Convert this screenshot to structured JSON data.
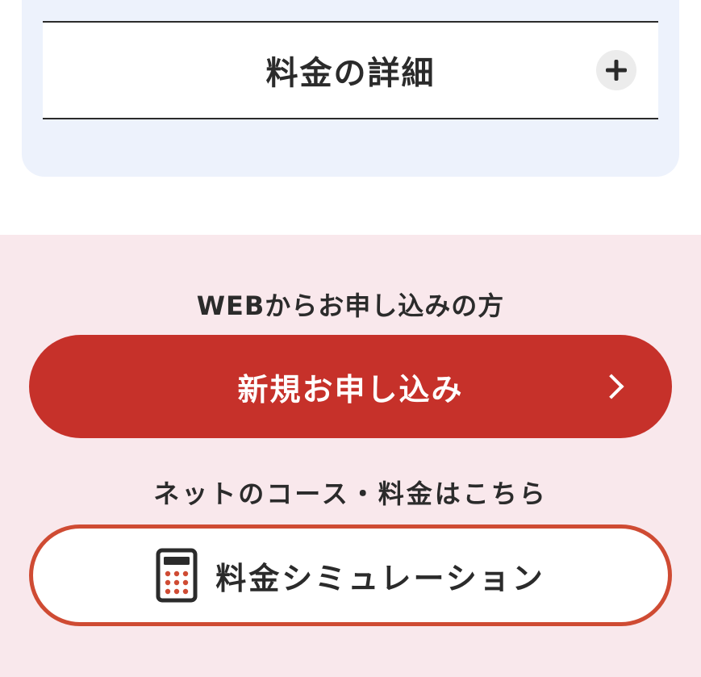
{
  "details": {
    "title": "料金の詳細",
    "toggle_icon": "plus-icon"
  },
  "web_apply": {
    "heading": "WEBからお申し込みの方",
    "button_label": "新規お申し込み",
    "button_icon": "chevron-right-icon"
  },
  "net_course": {
    "heading": "ネットのコース・料金はこちら",
    "button_label": "料金シミュレーション",
    "button_icon": "calculator-icon"
  },
  "colors": {
    "card_background": "#edf2fc",
    "section_background": "#f9e8ec",
    "primary_red": "#c6312a",
    "outline_red": "#cf4b33",
    "text_dark": "#2b2b2b"
  }
}
